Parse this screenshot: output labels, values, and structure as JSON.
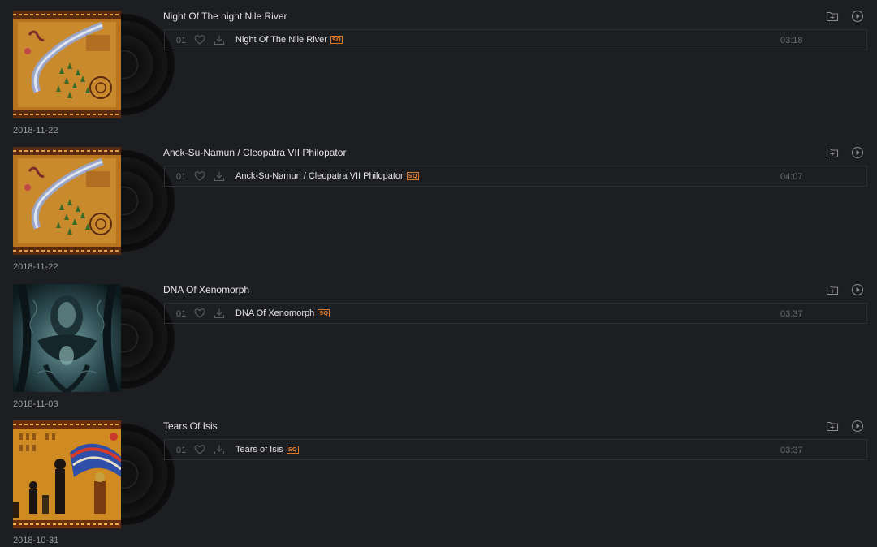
{
  "albums": [
    {
      "title": "Night Of The night Nile River",
      "date": "2018-11-22",
      "cover": "egyptian-map-art",
      "tracks": [
        {
          "number": "01",
          "name": "Night Of The Nile River",
          "quality": "SQ",
          "duration": "03:18"
        }
      ]
    },
    {
      "title": "Anck-Su-Namun / Cleopatra VII Philopator",
      "date": "2018-11-22",
      "cover": "egyptian-map-art",
      "tracks": [
        {
          "number": "01",
          "name": "Anck-Su-Namun / Cleopatra VII Philopator",
          "quality": "SQ",
          "duration": "04:07"
        }
      ]
    },
    {
      "title": "DNA Of Xenomorph",
      "date": "2018-11-03",
      "cover": "biomechanical-art",
      "tracks": [
        {
          "number": "01",
          "name": "DNA Of Xenomorph",
          "quality": "SQ",
          "duration": "03:37"
        }
      ]
    },
    {
      "title": "Tears Of Isis",
      "date": "2018-10-31",
      "cover": "egyptian-isis-art",
      "tracks": [
        {
          "number": "01",
          "name": "Tears of Isis",
          "quality": "SQ",
          "duration": "03:37"
        }
      ]
    }
  ],
  "icons": {
    "add": "folder-add-icon",
    "play": "play-circle-icon",
    "like": "heart-icon",
    "download": "download-icon"
  },
  "colors": {
    "background": "#1d1e22",
    "sq_badge": "#d9772a",
    "text": "#e6e6e6",
    "muted": "#6b6c70"
  }
}
